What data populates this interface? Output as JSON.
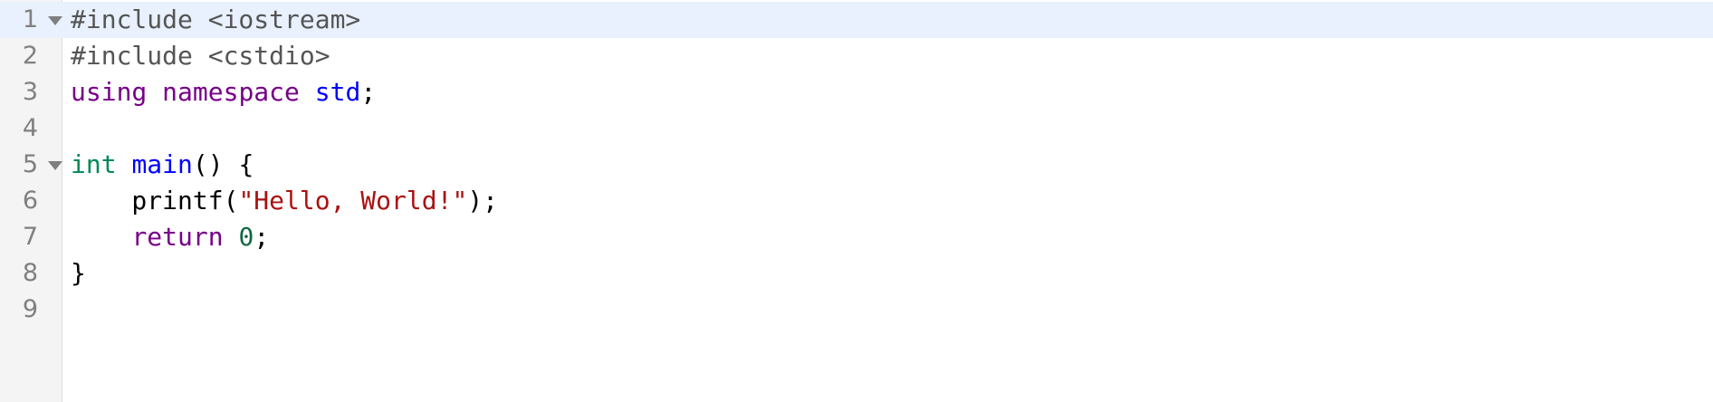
{
  "editor": {
    "colors": {
      "active_line_bg": "#e8f1fd",
      "gutter_bg": "#f4f4f4",
      "preprocessor": "#555555",
      "keyword": "#770088",
      "type": "#008855",
      "definition": "#0000ff",
      "string": "#aa1111",
      "number": "#116644"
    },
    "fold_icon": "triangle-down-icon",
    "lines": [
      {
        "number": "1",
        "tokens": [
          {
            "text": "#include <iostream>",
            "kind": "preproc"
          }
        ]
      },
      {
        "number": "2",
        "tokens": [
          {
            "text": "#include <cstdio>",
            "kind": "preproc"
          }
        ]
      },
      {
        "number": "3",
        "tokens": [
          {
            "text": "using",
            "kind": "keyword"
          },
          {
            "text": " ",
            "kind": "plain"
          },
          {
            "text": "namespace",
            "kind": "keyword"
          },
          {
            "text": " ",
            "kind": "plain"
          },
          {
            "text": "std",
            "kind": "namespace"
          },
          {
            "text": ";",
            "kind": "plain"
          }
        ]
      },
      {
        "number": "4",
        "tokens": []
      },
      {
        "number": "5",
        "tokens": [
          {
            "text": "int",
            "kind": "type"
          },
          {
            "text": " ",
            "kind": "plain"
          },
          {
            "text": "main",
            "kind": "def"
          },
          {
            "text": "() {",
            "kind": "plain"
          }
        ]
      },
      {
        "number": "6",
        "tokens": [
          {
            "text": "    printf(",
            "kind": "plain"
          },
          {
            "text": "\"Hello, World!\"",
            "kind": "string"
          },
          {
            "text": ");",
            "kind": "plain"
          }
        ]
      },
      {
        "number": "7",
        "tokens": [
          {
            "text": "    ",
            "kind": "plain"
          },
          {
            "text": "return",
            "kind": "keyword"
          },
          {
            "text": " ",
            "kind": "plain"
          },
          {
            "text": "0",
            "kind": "number"
          },
          {
            "text": ";",
            "kind": "plain"
          }
        ]
      },
      {
        "number": "8",
        "tokens": [
          {
            "text": "}",
            "kind": "plain"
          }
        ]
      },
      {
        "number": "9",
        "tokens": []
      }
    ]
  }
}
